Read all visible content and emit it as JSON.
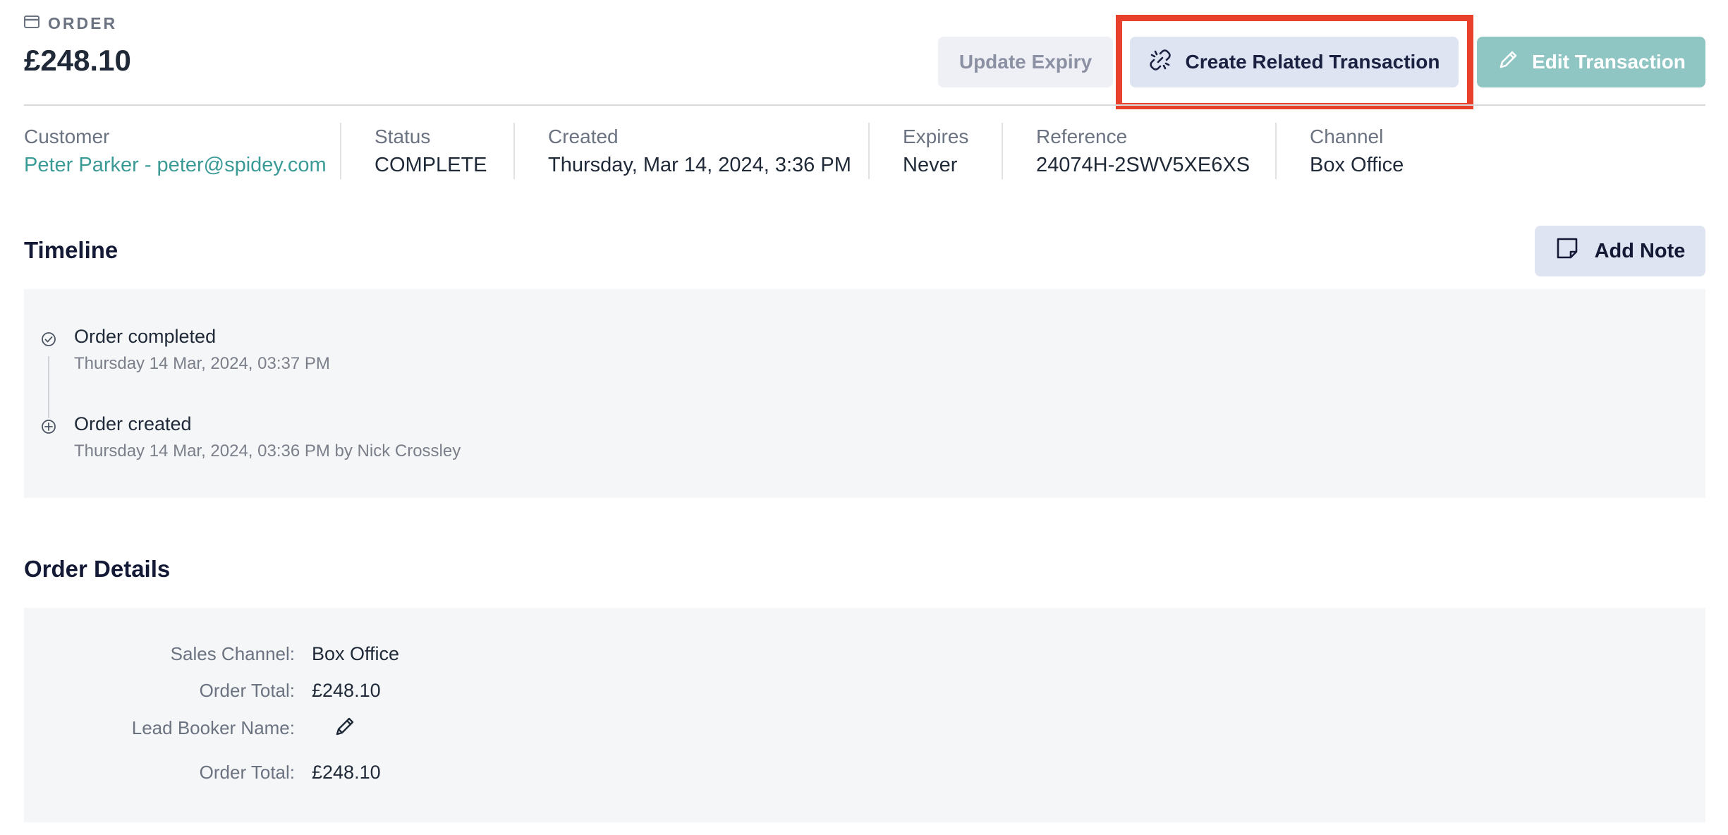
{
  "header": {
    "section_label": "ORDER",
    "amount": "£248.10",
    "icon": "credit-card-icon"
  },
  "actions": {
    "update_expiry": "Update Expiry",
    "create_related": "Create Related Transaction",
    "edit_transaction": "Edit Transaction",
    "highlight_color": "#e8402b"
  },
  "meta": {
    "customer_label": "Customer",
    "customer_value": "Peter Parker - peter@spidey.com",
    "status_label": "Status",
    "status_value": "COMPLETE",
    "created_label": "Created",
    "created_value": "Thursday, Mar 14, 2024, 3:36 PM",
    "expires_label": "Expires",
    "expires_value": "Never",
    "reference_label": "Reference",
    "reference_value": "24074H-2SWV5XE6XS",
    "channel_label": "Channel",
    "channel_value": "Box Office"
  },
  "timeline": {
    "title": "Timeline",
    "add_note": "Add Note",
    "items": [
      {
        "title": "Order completed",
        "sub": "Thursday 14 Mar, 2024, 03:37 PM",
        "icon": "check-circle-icon"
      },
      {
        "title": "Order created",
        "sub": "Thursday 14 Mar, 2024, 03:36 PM by Nick Crossley",
        "icon": "plus-circle-icon"
      }
    ]
  },
  "order_details": {
    "title": "Order Details",
    "rows": [
      {
        "label": "Sales Channel:",
        "value": "Box Office"
      },
      {
        "label": "Order Total:",
        "value": "£248.10"
      },
      {
        "label": "Lead Booker Name:",
        "value": "",
        "icon": "pencil-icon"
      },
      {
        "label": "Order Total:",
        "value": "£248.10"
      }
    ]
  },
  "colors": {
    "accent_teal": "#3a9a96",
    "button_secondary": "#dfe4f3",
    "button_disabled_teal": "#8fc6c4",
    "panel_bg": "#f5f6f8"
  }
}
